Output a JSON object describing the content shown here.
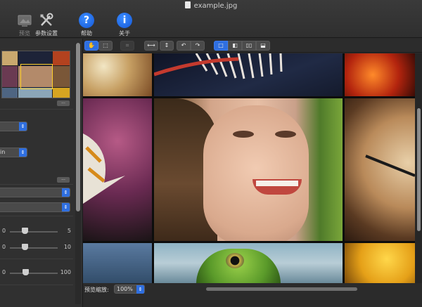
{
  "window": {
    "title": "example.jpg"
  },
  "toolbar": {
    "preview_label": "预览",
    "settings_label": "参数设置",
    "help_label": "帮助",
    "about_label": "关于",
    "help_glyph": "?",
    "about_glyph": "i"
  },
  "left_panel": {
    "more_button_1": "...",
    "more_button_2": "...",
    "dropdown_1_value": "",
    "dropdown_2_value": "in",
    "dropdown_3_value": "",
    "dropdown_4_value": "",
    "slider_1": {
      "min": "0",
      "max": "5",
      "level": 0.28
    },
    "slider_2": {
      "min": "0",
      "max": "10",
      "level": 0.28
    },
    "slider_3": {
      "min": "0",
      "max": "100",
      "level": 0.3
    }
  },
  "image_toolbar": {
    "tools": [
      "hand-tool",
      "select-tool",
      "crop-tool",
      "fit-width",
      "fit-height",
      "rotate-left",
      "rotate-right",
      "view-single",
      "view-split-vertical",
      "view-side-by-side",
      "view-split-horizontal"
    ]
  },
  "status_bar": {
    "zoom_label": "预览缩放:",
    "zoom_value": "100%"
  },
  "colors": {
    "accent": "#2f6fe0",
    "background": "#2b2b2b"
  }
}
